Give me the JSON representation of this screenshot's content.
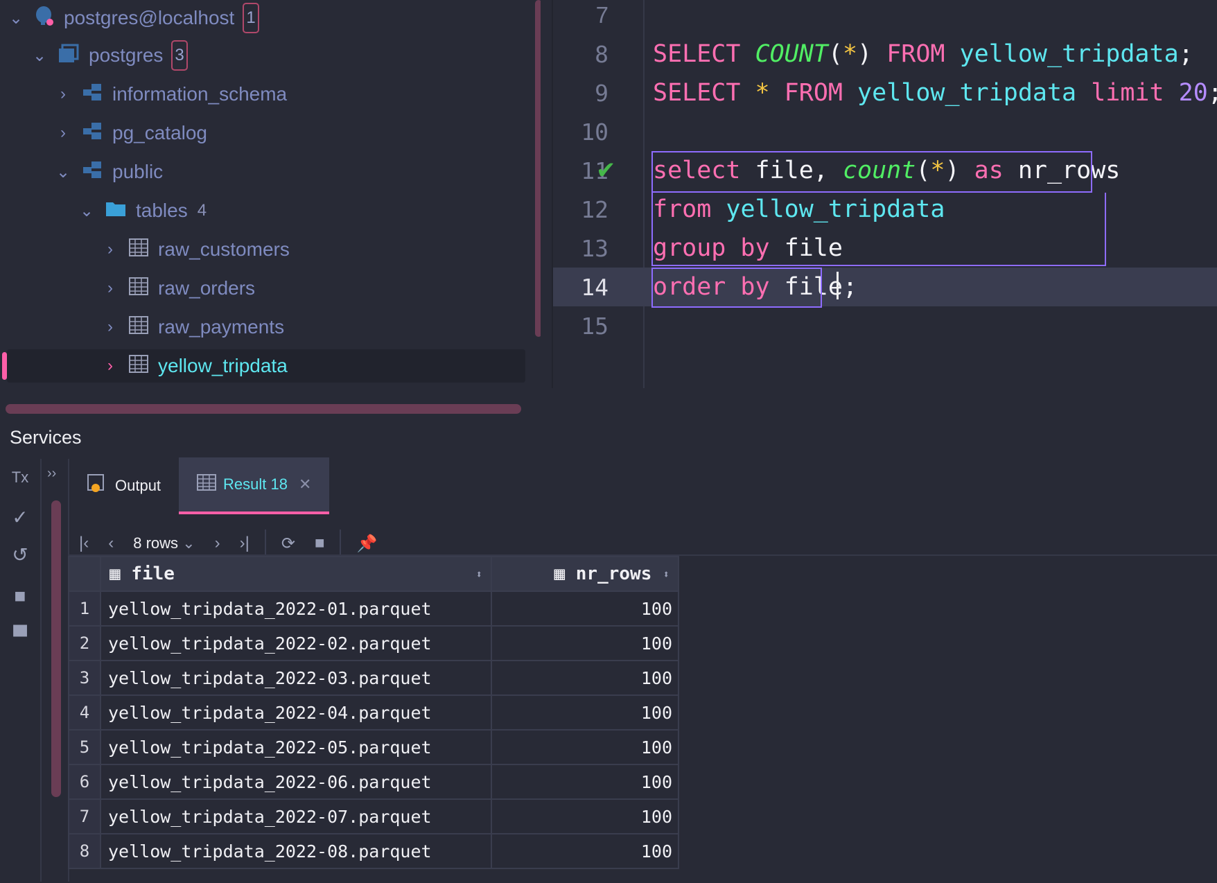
{
  "tree": {
    "connection": {
      "label": "postgres@localhost",
      "badge": "1"
    },
    "database": {
      "label": "postgres",
      "badge": "3"
    },
    "schemas": [
      "information_schema",
      "pg_catalog",
      "public"
    ],
    "tables_folder": {
      "label": "tables",
      "count": "4"
    },
    "tables": [
      "raw_customers",
      "raw_orders",
      "raw_payments",
      "yellow_tripdata"
    ]
  },
  "editor": {
    "line_numbers": [
      "7",
      "8",
      "9",
      "10",
      "11",
      "12",
      "13",
      "14",
      "15"
    ]
  },
  "services": {
    "title": "Services",
    "tx_label": "Tx",
    "tabs": [
      {
        "label": "Output"
      },
      {
        "label": "Result 18"
      }
    ],
    "rows_selector": "8 rows",
    "columns": [
      "file",
      "nr_rows"
    ],
    "rows": [
      {
        "n": "1",
        "file": "yellow_tripdata_2022-01.parquet",
        "nr_rows": "100"
      },
      {
        "n": "2",
        "file": "yellow_tripdata_2022-02.parquet",
        "nr_rows": "100"
      },
      {
        "n": "3",
        "file": "yellow_tripdata_2022-03.parquet",
        "nr_rows": "100"
      },
      {
        "n": "4",
        "file": "yellow_tripdata_2022-04.parquet",
        "nr_rows": "100"
      },
      {
        "n": "5",
        "file": "yellow_tripdata_2022-05.parquet",
        "nr_rows": "100"
      },
      {
        "n": "6",
        "file": "yellow_tripdata_2022-06.parquet",
        "nr_rows": "100"
      },
      {
        "n": "7",
        "file": "yellow_tripdata_2022-07.parquet",
        "nr_rows": "100"
      },
      {
        "n": "8",
        "file": "yellow_tripdata_2022-08.parquet",
        "nr_rows": "100"
      }
    ]
  },
  "colors": {
    "accent_pink": "#ff5fa8",
    "accent_cyan": "#5ee7f0",
    "keyword": "#ff6fb2",
    "function": "#51ee64",
    "selection_border": "#8e6cff"
  }
}
